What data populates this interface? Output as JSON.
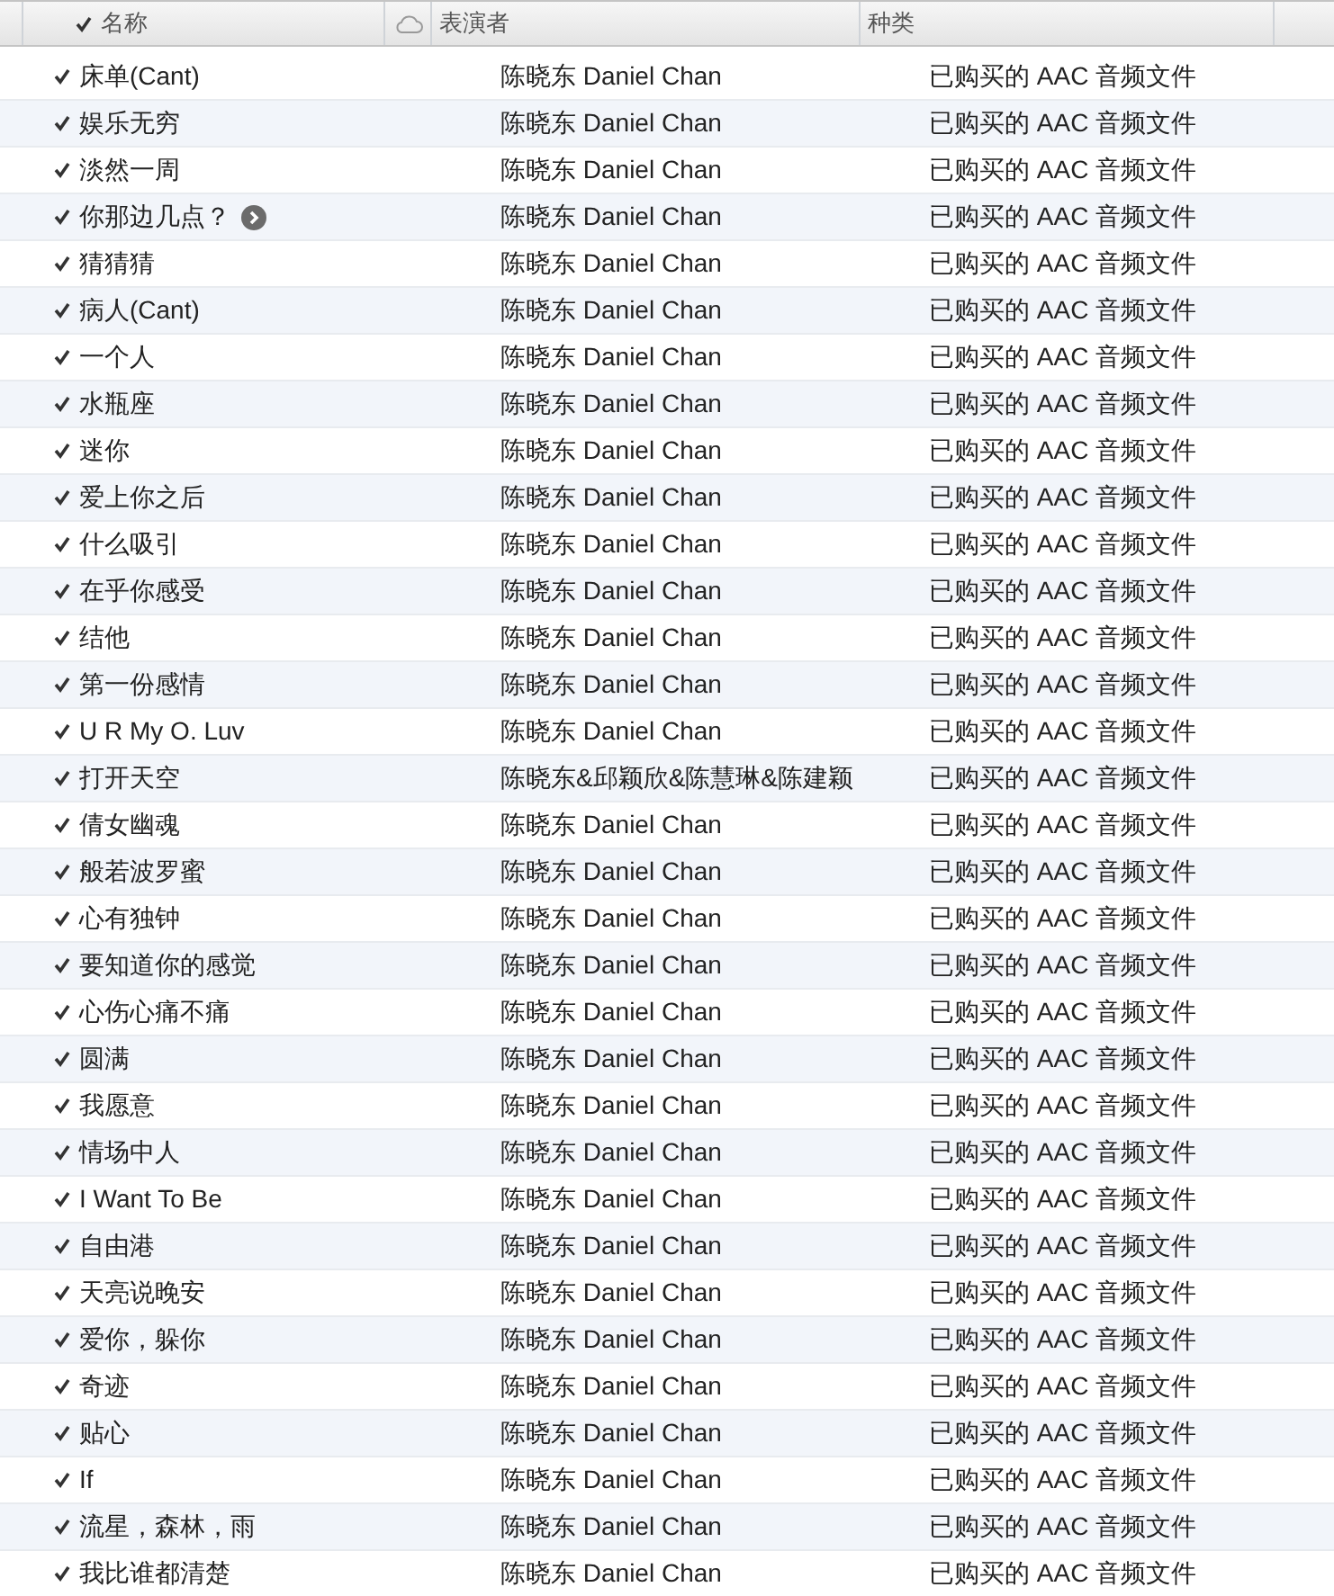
{
  "columns": [
    {
      "label": "名称",
      "kind": "checkbox",
      "checked": true
    },
    {
      "kind": "cloud"
    },
    {
      "label": "表演者"
    },
    {
      "label": "种类"
    }
  ],
  "rows": [
    {
      "title": "床单(Cant)",
      "artist": "陈晓东 Daniel Chan",
      "kind": "已购买的 AAC 音频文件",
      "checked": true,
      "arrow": false
    },
    {
      "title": "娱乐无穷",
      "artist": "陈晓东 Daniel Chan",
      "kind": "已购买的 AAC 音频文件",
      "checked": true,
      "arrow": false
    },
    {
      "title": "淡然一周",
      "artist": "陈晓东 Daniel Chan",
      "kind": "已购买的 AAC 音频文件",
      "checked": true,
      "arrow": false
    },
    {
      "title": "你那边几点？",
      "artist": "陈晓东 Daniel Chan",
      "kind": "已购买的 AAC 音频文件",
      "checked": true,
      "arrow": true
    },
    {
      "title": "猜猜猜",
      "artist": "陈晓东 Daniel Chan",
      "kind": "已购买的 AAC 音频文件",
      "checked": true,
      "arrow": false
    },
    {
      "title": "病人(Cant)",
      "artist": "陈晓东 Daniel Chan",
      "kind": "已购买的 AAC 音频文件",
      "checked": true,
      "arrow": false
    },
    {
      "title": "一个人",
      "artist": "陈晓东 Daniel Chan",
      "kind": "已购买的 AAC 音频文件",
      "checked": true,
      "arrow": false
    },
    {
      "title": "水瓶座",
      "artist": "陈晓东 Daniel Chan",
      "kind": "已购买的 AAC 音频文件",
      "checked": true,
      "arrow": false
    },
    {
      "title": "迷你",
      "artist": "陈晓东 Daniel Chan",
      "kind": "已购买的 AAC 音频文件",
      "checked": true,
      "arrow": false
    },
    {
      "title": "爱上你之后",
      "artist": "陈晓东 Daniel Chan",
      "kind": "已购买的 AAC 音频文件",
      "checked": true,
      "arrow": false
    },
    {
      "title": "什么吸引",
      "artist": "陈晓东 Daniel Chan",
      "kind": "已购买的 AAC 音频文件",
      "checked": true,
      "arrow": false
    },
    {
      "title": "在乎你感受",
      "artist": "陈晓东 Daniel Chan",
      "kind": "已购买的 AAC 音频文件",
      "checked": true,
      "arrow": false
    },
    {
      "title": "结他",
      "artist": "陈晓东 Daniel Chan",
      "kind": "已购买的 AAC 音频文件",
      "checked": true,
      "arrow": false
    },
    {
      "title": "第一份感情",
      "artist": "陈晓东 Daniel Chan",
      "kind": "已购买的 AAC 音频文件",
      "checked": true,
      "arrow": false
    },
    {
      "title": "U R My O. Luv",
      "artist": "陈晓东 Daniel Chan",
      "kind": "已购买的 AAC 音频文件",
      "checked": true,
      "arrow": false
    },
    {
      "title": "打开天空",
      "artist": "陈晓东&邱颖欣&陈慧琳&陈建颖",
      "kind": "已购买的 AAC 音频文件",
      "checked": true,
      "arrow": false
    },
    {
      "title": "倩女幽魂",
      "artist": "陈晓东 Daniel Chan",
      "kind": "已购买的 AAC 音频文件",
      "checked": true,
      "arrow": false
    },
    {
      "title": "般若波罗蜜",
      "artist": "陈晓东 Daniel Chan",
      "kind": "已购买的 AAC 音频文件",
      "checked": true,
      "arrow": false
    },
    {
      "title": "心有独钟",
      "artist": "陈晓东 Daniel Chan",
      "kind": "已购买的 AAC 音频文件",
      "checked": true,
      "arrow": false
    },
    {
      "title": "要知道你的感觉",
      "artist": "陈晓东 Daniel Chan",
      "kind": "已购买的 AAC 音频文件",
      "checked": true,
      "arrow": false
    },
    {
      "title": "心伤心痛不痛",
      "artist": "陈晓东 Daniel Chan",
      "kind": "已购买的 AAC 音频文件",
      "checked": true,
      "arrow": false
    },
    {
      "title": "圆满",
      "artist": "陈晓东 Daniel Chan",
      "kind": "已购买的 AAC 音频文件",
      "checked": true,
      "arrow": false
    },
    {
      "title": "我愿意",
      "artist": "陈晓东 Daniel Chan",
      "kind": "已购买的 AAC 音频文件",
      "checked": true,
      "arrow": false
    },
    {
      "title": "情场中人",
      "artist": "陈晓东 Daniel Chan",
      "kind": "已购买的 AAC 音频文件",
      "checked": true,
      "arrow": false
    },
    {
      "title": "I Want To Be",
      "artist": "陈晓东 Daniel Chan",
      "kind": "已购买的 AAC 音频文件",
      "checked": true,
      "arrow": false
    },
    {
      "title": "自由港",
      "artist": "陈晓东 Daniel Chan",
      "kind": "已购买的 AAC 音频文件",
      "checked": true,
      "arrow": false
    },
    {
      "title": "天亮说晚安",
      "artist": "陈晓东 Daniel Chan",
      "kind": "已购买的 AAC 音频文件",
      "checked": true,
      "arrow": false
    },
    {
      "title": "爱你，躲你",
      "artist": "陈晓东 Daniel Chan",
      "kind": "已购买的 AAC 音频文件",
      "checked": true,
      "arrow": false
    },
    {
      "title": "奇迹",
      "artist": "陈晓东 Daniel Chan",
      "kind": "已购买的 AAC 音频文件",
      "checked": true,
      "arrow": false
    },
    {
      "title": "贴心",
      "artist": "陈晓东 Daniel Chan",
      "kind": "已购买的 AAC 音频文件",
      "checked": true,
      "arrow": false
    },
    {
      "title": "If",
      "artist": "陈晓东 Daniel Chan",
      "kind": "已购买的 AAC 音频文件",
      "checked": true,
      "arrow": false
    },
    {
      "title": "流星，森林，雨",
      "artist": "陈晓东 Daniel Chan",
      "kind": "已购买的 AAC 音频文件",
      "checked": true,
      "arrow": false
    },
    {
      "title": "我比谁都清楚",
      "artist": "陈晓东 Daniel Chan",
      "kind": "已购买的 AAC 音频文件",
      "checked": true,
      "arrow": false
    }
  ]
}
